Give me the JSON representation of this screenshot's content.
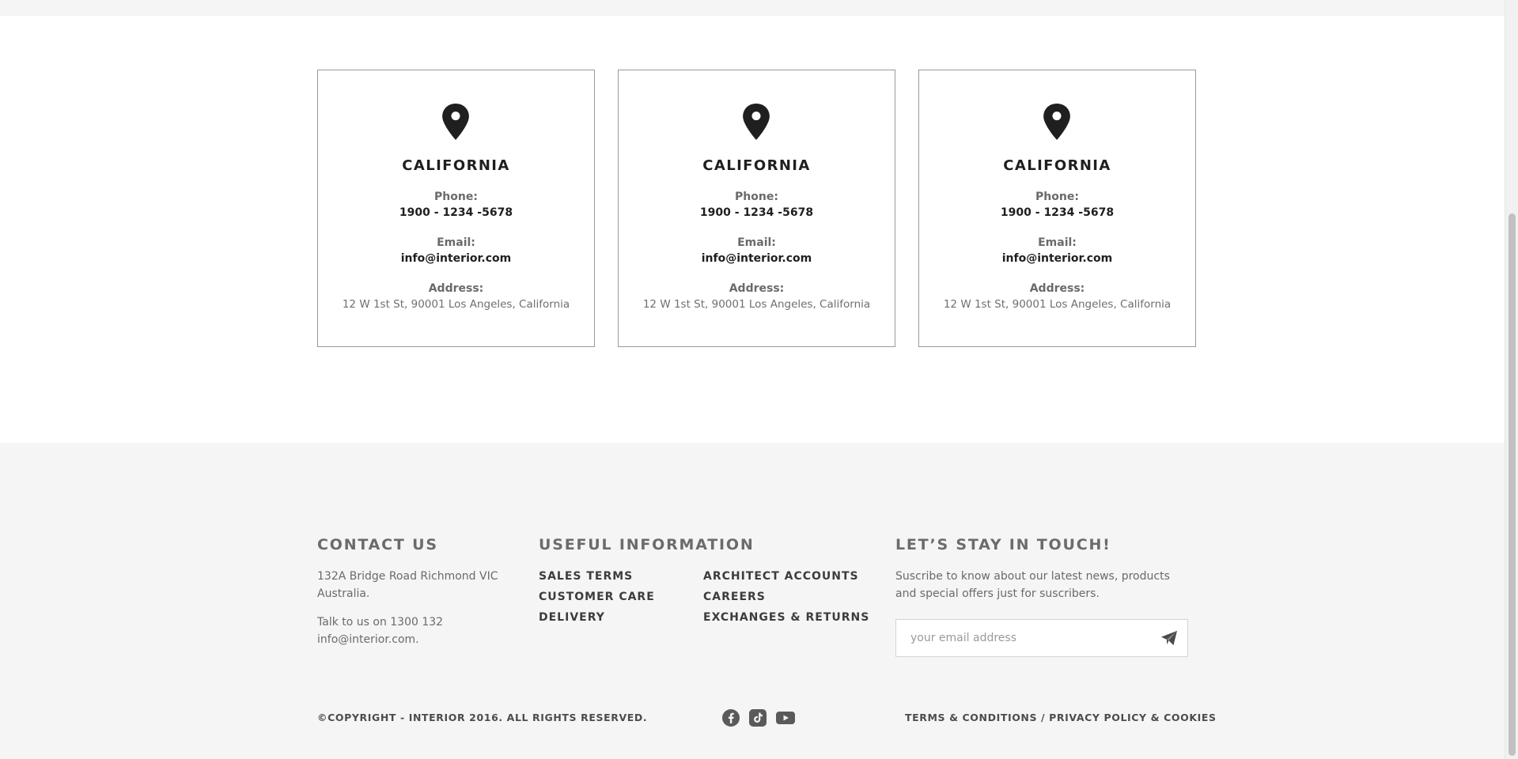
{
  "locations": [
    {
      "city": "CALIFORNIA",
      "phone_label": "Phone:",
      "phone": "1900 - 1234 -5678",
      "email_label": "Email:",
      "email": "info@interior.com",
      "address_label": "Address:",
      "address": "12 W 1st St, 90001 Los Angeles, California"
    },
    {
      "city": "CALIFORNIA",
      "phone_label": "Phone:",
      "phone": "1900 - 1234 -5678",
      "email_label": "Email:",
      "email": "info@interior.com",
      "address_label": "Address:",
      "address": "12 W 1st St, 90001 Los Angeles, California"
    },
    {
      "city": "CALIFORNIA",
      "phone_label": "Phone:",
      "phone": "1900 - 1234 -5678",
      "email_label": "Email:",
      "email": "info@interior.com",
      "address_label": "Address:",
      "address": "12 W 1st St, 90001 Los Angeles, California"
    }
  ],
  "footer": {
    "contact": {
      "heading": "CONTACT US",
      "address_line1": "132A Bridge Road Richmond VIC",
      "address_line2": "Australia.",
      "talk_line1": "Talk to us on 1300 132",
      "talk_line2": "info@interior.com."
    },
    "useful": {
      "heading": "USEFUL INFORMATION",
      "links_col1": [
        "SALES TERMS",
        "CUSTOMER CARE",
        "DELIVERY"
      ],
      "links_col2": [
        "ARCHITECT ACCOUNTS",
        "CAREERS",
        "EXCHANGES & RETURNS"
      ]
    },
    "newsletter": {
      "heading": "LET’S STAY IN TOUCH!",
      "text_line1": "Suscribe to know about our latest news, products",
      "text_line2": "and special offers just for suscribers.",
      "placeholder": "your email address"
    },
    "copyright": "©COPYRIGHT - INTERIOR 2016. ALL RIGHTS RESERVED.",
    "social_icons": [
      "facebook-icon",
      "tiktok-icon",
      "youtube-icon"
    ],
    "legal_links": "TERMS & CONDITIONS / PRIVACY POLICY & COOKIES"
  },
  "colors": {
    "page_background": "#ffffff",
    "footer_background": "#f5f5f5",
    "card_border": "#9a9a9a",
    "heading_text": "#1f1f1f",
    "muted_text": "#6a6a6a"
  }
}
